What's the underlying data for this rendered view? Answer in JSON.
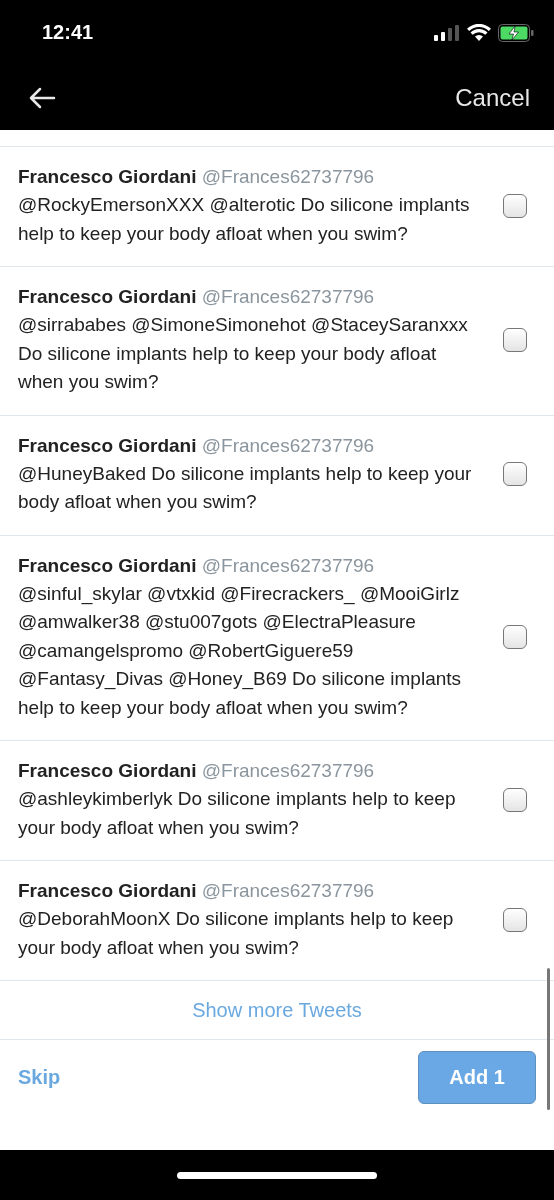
{
  "status_bar": {
    "time": "12:41"
  },
  "nav": {
    "cancel": "Cancel"
  },
  "tweets": [
    {
      "name": "Francesco Giordani",
      "handle": "@Frances62737796",
      "text": "@RockyEmersonXXX @alterotic Do silicone implants help to keep your body afloat when you swim?",
      "checked": false
    },
    {
      "name": "Francesco Giordani",
      "handle": "@Frances62737796",
      "text": "@sirrababes @SimoneSimonehot @StaceySaranxxx Do silicone implants help to keep your body afloat when you swim?",
      "checked": false
    },
    {
      "name": "Francesco Giordani",
      "handle": "@Frances62737796",
      "text": "@HuneyBaked Do silicone implants help to keep your body afloat when you swim?",
      "checked": false
    },
    {
      "name": "Francesco Giordani",
      "handle": "@Frances62737796",
      "text": "@sinful_skylar @vtxkid @Firecrackers_ @MooiGirlz @amwalker38 @stu007gots @ElectraPleasure @camangelspromo @RobertGiguere59 @Fantasy_Divas @Honey_B69 Do silicone implants help to keep your body afloat when you swim?",
      "checked": false
    },
    {
      "name": "Francesco Giordani",
      "handle": "@Frances62737796",
      "text": "@ashleykimberlyk Do silicone implants help to keep your body afloat when you swim?",
      "checked": false
    },
    {
      "name": "Francesco Giordani",
      "handle": "@Frances62737796",
      "text": "@DeborahMoonX Do silicone implants help to keep your body afloat when you swim?",
      "checked": false
    }
  ],
  "show_more": "Show more Tweets",
  "footer": {
    "skip": "Skip",
    "add": "Add 1"
  }
}
